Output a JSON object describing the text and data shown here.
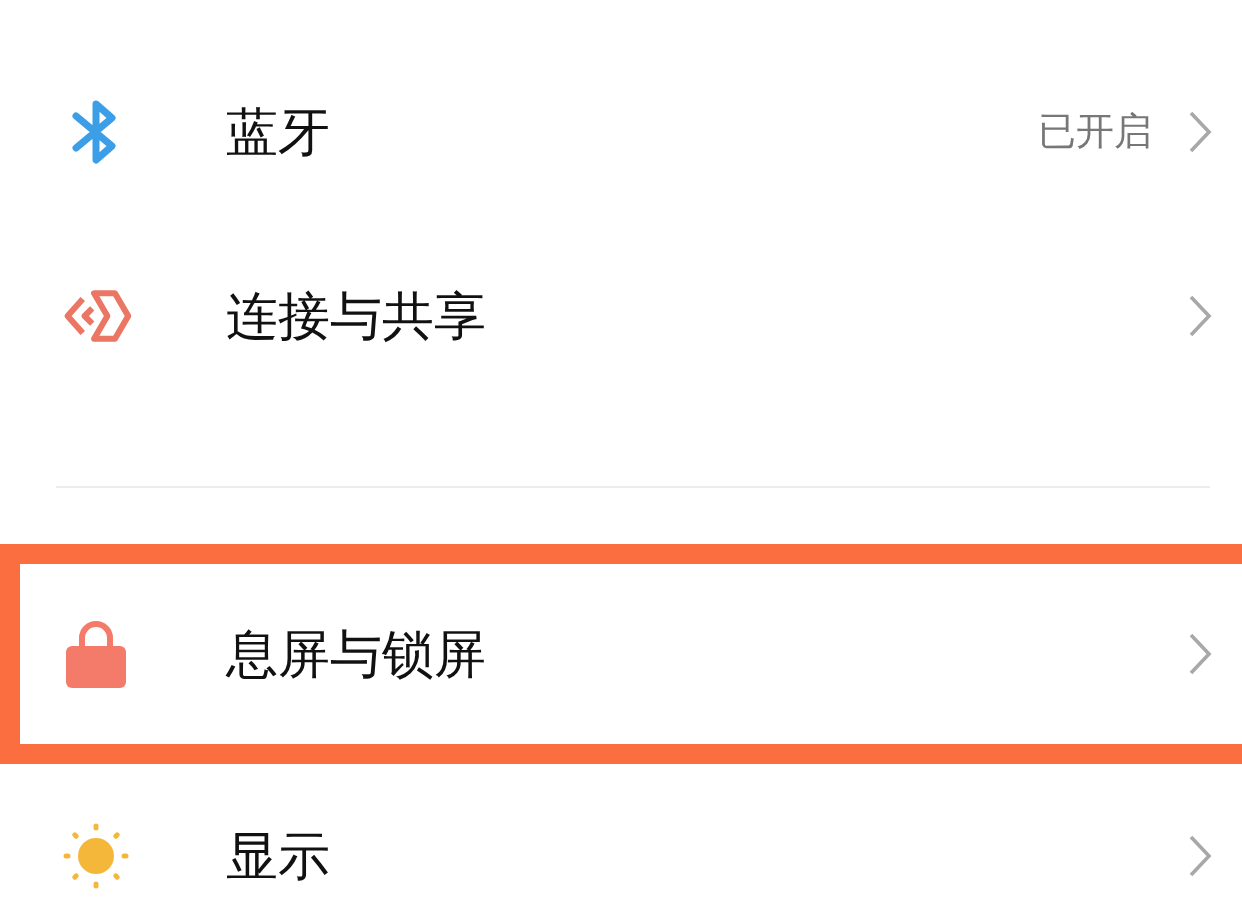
{
  "sections": [
    {
      "items": [
        {
          "kind": "bluetooth",
          "label": "蓝牙",
          "value": "已开启",
          "highlighted": false
        },
        {
          "kind": "share",
          "label": "连接与共享",
          "highlighted": false
        }
      ]
    },
    {
      "items": [
        {
          "kind": "lock",
          "label": "息屏与锁屏",
          "highlighted": true
        },
        {
          "kind": "sun",
          "label": "显示",
          "highlighted": false
        }
      ]
    }
  ]
}
